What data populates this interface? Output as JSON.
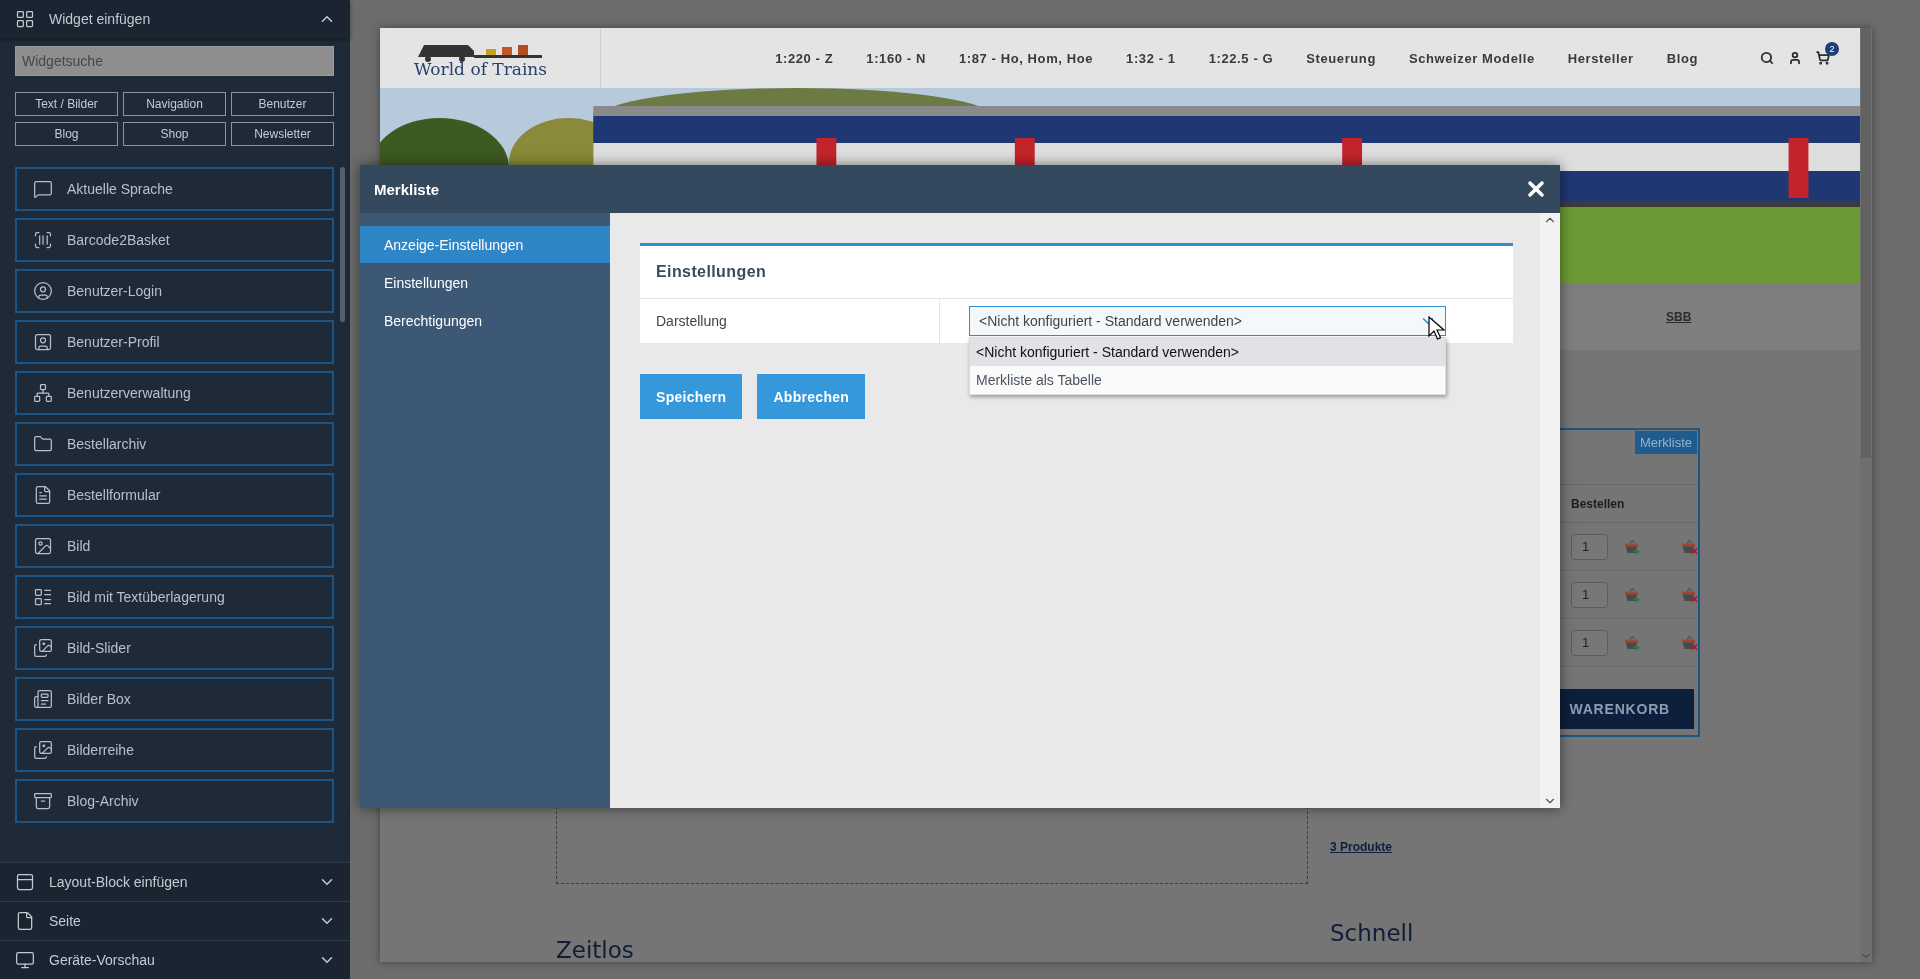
{
  "sidebar": {
    "widget_panel": {
      "title": "Widget einfügen",
      "expanded": true,
      "search": {
        "placeholder": "Widgetsuche"
      },
      "categories": [
        {
          "label": "Text / Bilder"
        },
        {
          "label": "Navigation"
        },
        {
          "label": "Benutzer"
        },
        {
          "label": "Blog"
        },
        {
          "label": "Shop"
        },
        {
          "label": "Newsletter"
        }
      ],
      "widgets": [
        {
          "label": "Aktuelle Sprache"
        },
        {
          "label": "Barcode2Basket"
        },
        {
          "label": "Benutzer-Login"
        },
        {
          "label": "Benutzer-Profil"
        },
        {
          "label": "Benutzerverwaltung"
        },
        {
          "label": "Bestellarchiv"
        },
        {
          "label": "Bestellformular"
        },
        {
          "label": "Bild"
        },
        {
          "label": "Bild mit Textüberlagerung"
        },
        {
          "label": "Bild-Slider"
        },
        {
          "label": "Bilder Box"
        },
        {
          "label": "Bilderreihe"
        },
        {
          "label": "Blog-Archiv"
        }
      ]
    },
    "collapsed_sections": [
      {
        "title": "Layout-Block einfügen",
        "expanded": false
      },
      {
        "title": "Seite",
        "expanded": false
      },
      {
        "title": "Geräte-Vorschau",
        "expanded": false
      }
    ]
  },
  "website": {
    "logo": "World of Trains",
    "nav": [
      "1:220 - Z",
      "1:160 - N",
      "1:87 - Ho, Hom, Hoe",
      "1:32 - 1",
      "1:22.5 - G",
      "Steuerung",
      "Schweizer Modelle",
      "Hersteller",
      "Blog"
    ],
    "cart_count": "2",
    "breadcrumb_link": "SBB",
    "watchlist_widget": {
      "tag": "Merkliste",
      "column_header": "Bestellen",
      "rows": [
        {
          "quantity": "1"
        },
        {
          "quantity": "1"
        },
        {
          "quantity": "1"
        }
      ],
      "cart_button": "WARENKORB"
    },
    "widget_link": "3 Produkte",
    "headings": [
      "Zeitlos",
      "Schnell"
    ]
  },
  "dialog": {
    "title": "Merkliste",
    "tabs": [
      {
        "label": "Anzeige-Einstellungen",
        "selected": true
      },
      {
        "label": "Einstellungen",
        "selected": false
      },
      {
        "label": "Berechtigungen",
        "selected": false
      }
    ],
    "card": {
      "title": "Einstellungen",
      "field_label": "Darstellung",
      "select": {
        "value": "<Nicht konfiguriert - Standard verwenden>",
        "expanded": true,
        "options": [
          {
            "label": "<Nicht konfiguriert - Standard verwenden>",
            "selected": true
          },
          {
            "label": "Merkliste als Tabelle",
            "selected": false
          }
        ]
      }
    },
    "buttons": [
      {
        "label": "Speichern"
      },
      {
        "label": "Abbrechen"
      }
    ]
  }
}
